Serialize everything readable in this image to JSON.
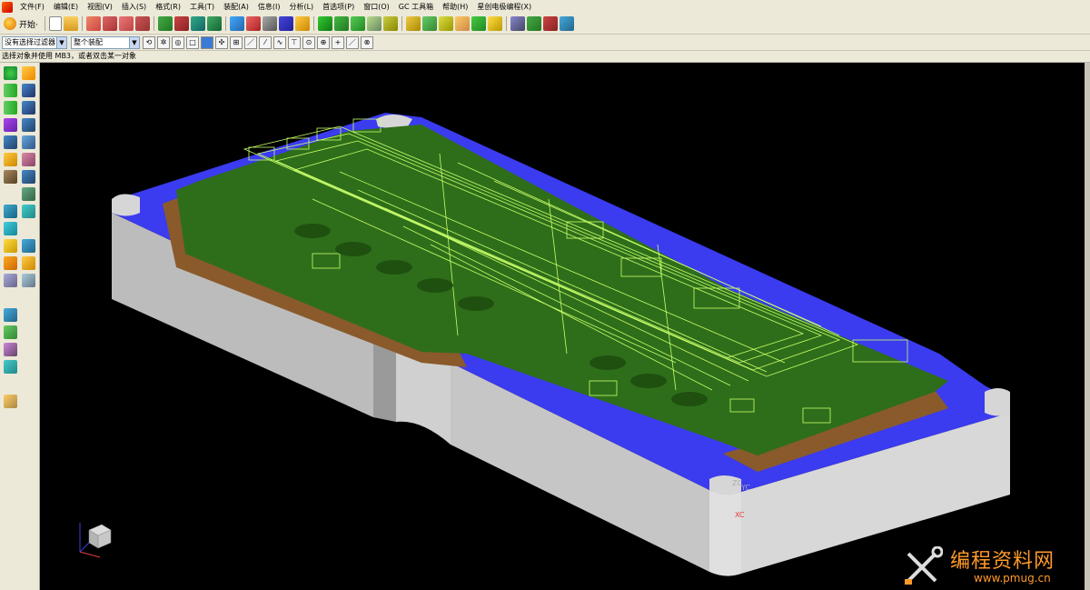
{
  "menubar": {
    "items": [
      "文件(F)",
      "编辑(E)",
      "视图(V)",
      "插入(S)",
      "格式(R)",
      "工具(T)",
      "装配(A)",
      "信息(I)",
      "分析(L)",
      "首选项(P)",
      "窗口(O)",
      "GC 工具箱",
      "帮助(H)",
      "星创电极编程(X)"
    ]
  },
  "toolbar": {
    "start_label": "开始·"
  },
  "selection_bar": {
    "filter_value": "没有选择过滤器",
    "scope_value": "整个装配"
  },
  "cue_line": "选择对象并使用 MB3，或者双击某一对象",
  "viewport": {
    "wcs_labels": {
      "xc": "XC",
      "yc": "YC",
      "zc": "ZC"
    }
  },
  "watermark": {
    "title": "编程资料网",
    "url": "www.pmug.cn"
  },
  "colors": {
    "chrome": "#ece9d8",
    "viewport_bg": "#000000",
    "base_gray": "#c8c8c8",
    "top_blue": "#3a3af0",
    "core_green": "#2e6e1a",
    "slope_brown": "#8a5a2a",
    "wireframe": "#c8ff6a",
    "watermark": "#ff9a2a"
  }
}
